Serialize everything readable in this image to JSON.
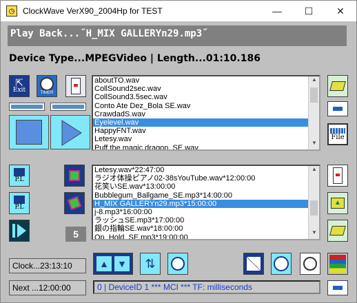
{
  "window": {
    "title": "ClockWave VerX90_2004Hp for TEST",
    "minimize": "—",
    "maximize": "☐",
    "close": "✕"
  },
  "playback_text": "Play Back...˝H_MIX GALLERYn29.mp3˝",
  "device_line": "Device Type...MPEGVideo  |  Length...01:10.186",
  "toolbar": {
    "exit_label": "Exit",
    "timer_label": "TIMER",
    "file_label": "File",
    "pl_label": "P.L"
  },
  "file_list": {
    "items": [
      "aboutTO.wav",
      "CollSound2sec.wav",
      "CollSound3.5sec.wav",
      "Conto Ate Dez_Bola SE.wav",
      "CrawdadS.wav",
      "Eyelevel.wav",
      "HappyFNT.wav",
      "Letesy.wav",
      "Puff the magic dragon_SE.wav"
    ],
    "selected_index": 5
  },
  "schedule_list": {
    "items": [
      "Letesy.wav*22:47:00",
      "ラジオ体操ピアノ02-38sYouTube.wav*12:00:00",
      "花笑いSE.wav*13:00:00",
      "Bubblegum_Ballgame_SE.mp3*14:00:00",
      "H_MIX GALLERYn29.mp3*15:00:00",
      "j-8.mp3*16:00:00",
      "ラッシュSE.mp3*17:00:00",
      "銀の指輪SE.wav*18:00:00",
      "On_Hold_SE.mp3*19:00:00"
    ],
    "selected_index": 4
  },
  "count_box": "5",
  "clock_text": "Clock...23:13:10",
  "next_text": "Next ...12:00:00",
  "mci_text": "0  |  DeviceID 1  ***  MCI  ***   TF:  milliseconds",
  "colors": {
    "panel": "#c0c0c0",
    "accent": "#3a8ee0",
    "cyan": "#80e8f8",
    "mci_text": "#1a3cc8"
  }
}
